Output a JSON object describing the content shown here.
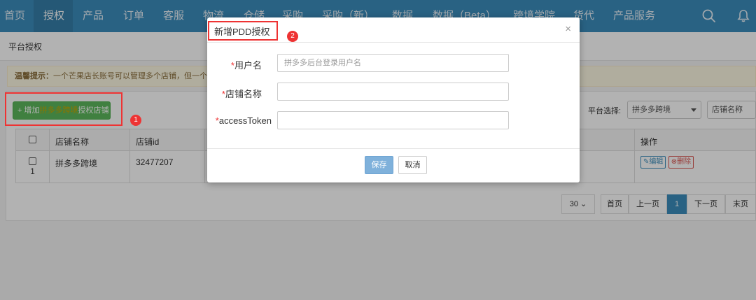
{
  "nav": {
    "items": [
      "首页",
      "授权",
      "产品",
      "订单",
      "客服",
      "物流",
      "仓储",
      "采购",
      "采购（新）",
      "数据",
      "数据（Beta）",
      "跨境学院",
      "货代",
      "产品服务"
    ],
    "active_index": 1,
    "search_icon": "search-icon",
    "bell_icon": "bell-icon"
  },
  "breadcrumb": "平台授权",
  "tip": {
    "prefix": "温馨提示：",
    "text": "一个芒果店长账号可以管理多个店铺，但一个店"
  },
  "add_button": {
    "plus": "+",
    "pre": "增加",
    "highlight": "拼多多跨境",
    "post": "授权店铺"
  },
  "filter": {
    "label": "平台选择:",
    "platform": "拼多多跨境",
    "shop_name": "店铺名称"
  },
  "table": {
    "headers": [
      "店铺名称",
      "店铺id",
      "操作"
    ],
    "row": {
      "index": "1",
      "shop_name": "拼多多跨境",
      "shop_id": "32477207",
      "edit": "编辑",
      "delete": "删除"
    }
  },
  "pagination": {
    "page_size": "30",
    "first": "首页",
    "prev": "上一页",
    "current": "1",
    "next": "下一页",
    "last": "末页"
  },
  "modal": {
    "title": "新增PDD授权",
    "close": "×",
    "fields": {
      "username_label": "用户名",
      "username_placeholder": "拼多多后台登录用户名",
      "shop_label": "店铺名称",
      "token_label": "accessToken"
    },
    "required_mark": "*",
    "save": "保存",
    "cancel": "取消"
  },
  "annotations": [
    "1",
    "2"
  ],
  "colors": {
    "nav_bg": "#3c8dbc",
    "annotation_red": "#ee3333",
    "success_green": "#5cb85c",
    "save_blue": "#7fb1db"
  }
}
